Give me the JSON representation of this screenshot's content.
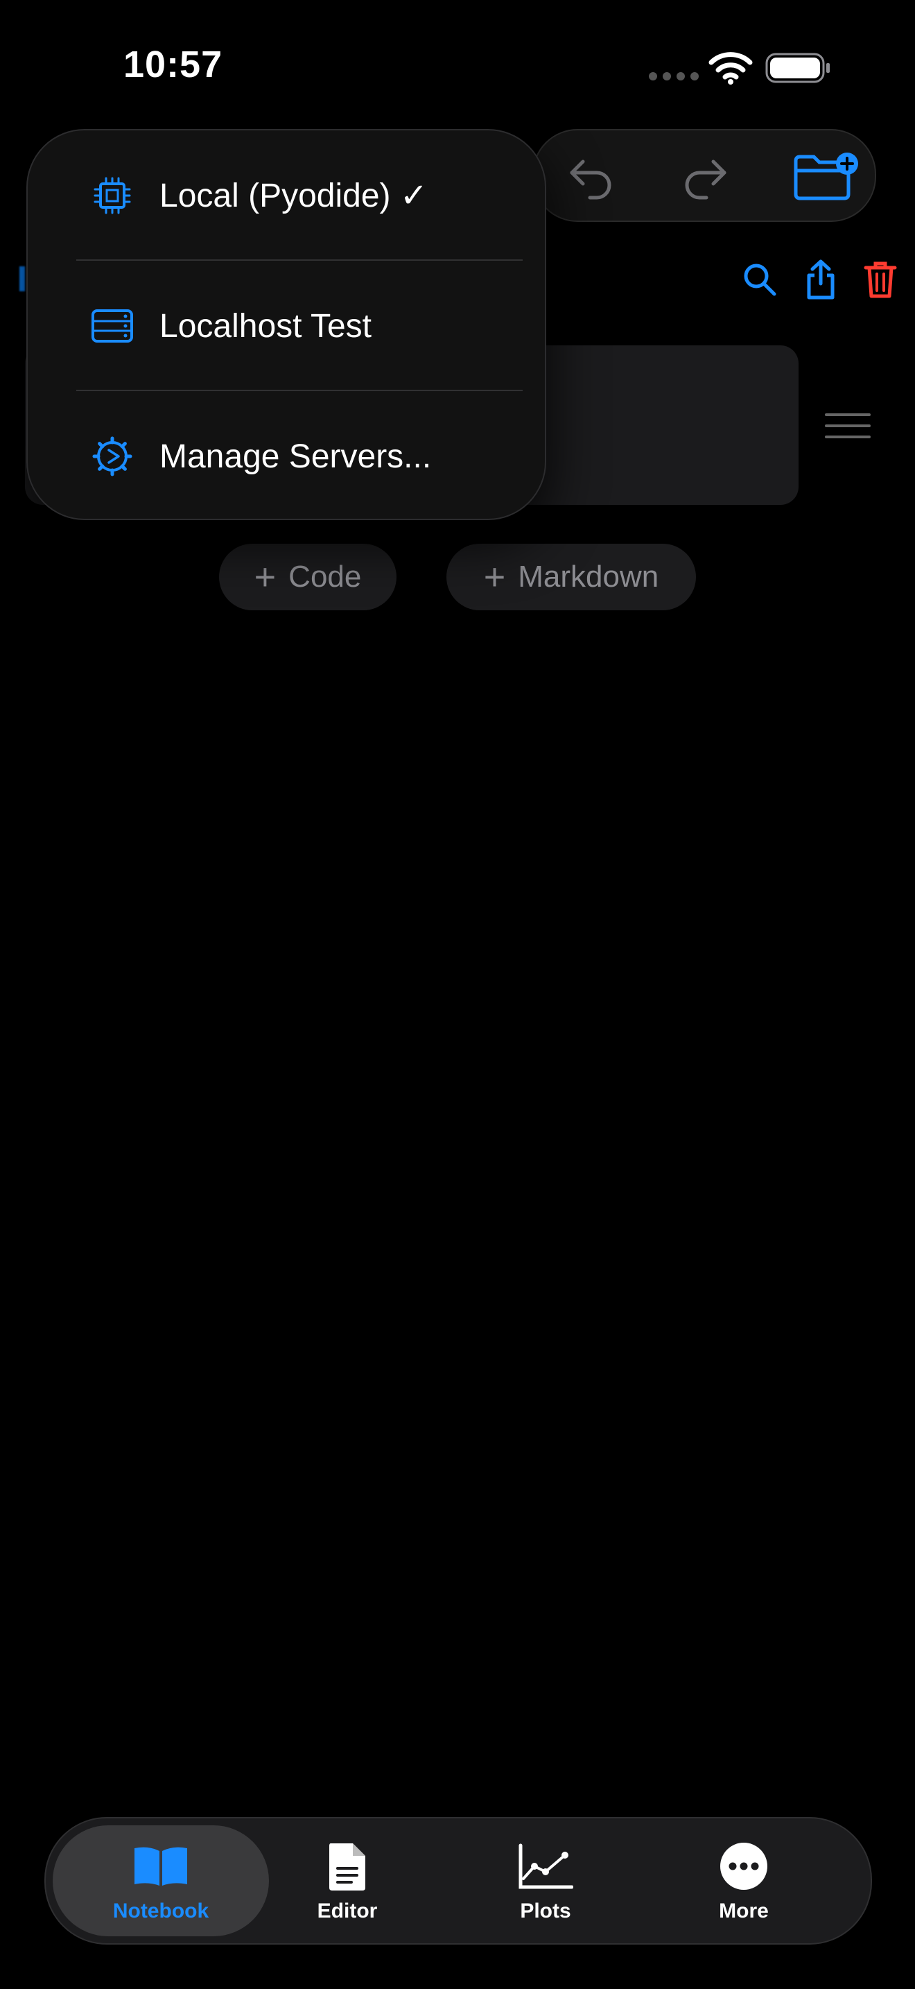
{
  "status_bar": {
    "time": "10:57",
    "icons": [
      "cellular-signal-icon",
      "wifi-icon",
      "battery-icon"
    ]
  },
  "toolbar": {
    "undo_icon": "undo-arrow-icon",
    "redo_icon": "redo-arrow-icon",
    "new_folder_icon": "folder-plus-icon",
    "search_icon": "search-icon",
    "share_icon": "share-icon",
    "delete_icon": "trash-icon"
  },
  "server_menu": {
    "items": [
      {
        "label": "Local (Pyodide) ✓",
        "icon": "cpu-chip-icon",
        "selected": true
      },
      {
        "label": "Localhost Test",
        "icon": "server-rack-icon",
        "selected": false
      },
      {
        "label": "Manage Servers...",
        "icon": "gear-play-icon",
        "selected": false
      }
    ]
  },
  "notebook": {
    "add_code_label": "Code",
    "add_markdown_label": "Markdown"
  },
  "tab_bar": {
    "tabs": [
      {
        "label": "Notebook",
        "icon": "book-open-icon",
        "active": true
      },
      {
        "label": "Editor",
        "icon": "document-icon",
        "active": false
      },
      {
        "label": "Plots",
        "icon": "line-chart-icon",
        "active": false
      },
      {
        "label": "More",
        "icon": "ellipsis-circle-icon",
        "active": false
      }
    ]
  },
  "colors": {
    "accent": "#1a8cff",
    "destructive": "#ff3b30",
    "background": "#000000",
    "surface": "#1c1c1e"
  }
}
